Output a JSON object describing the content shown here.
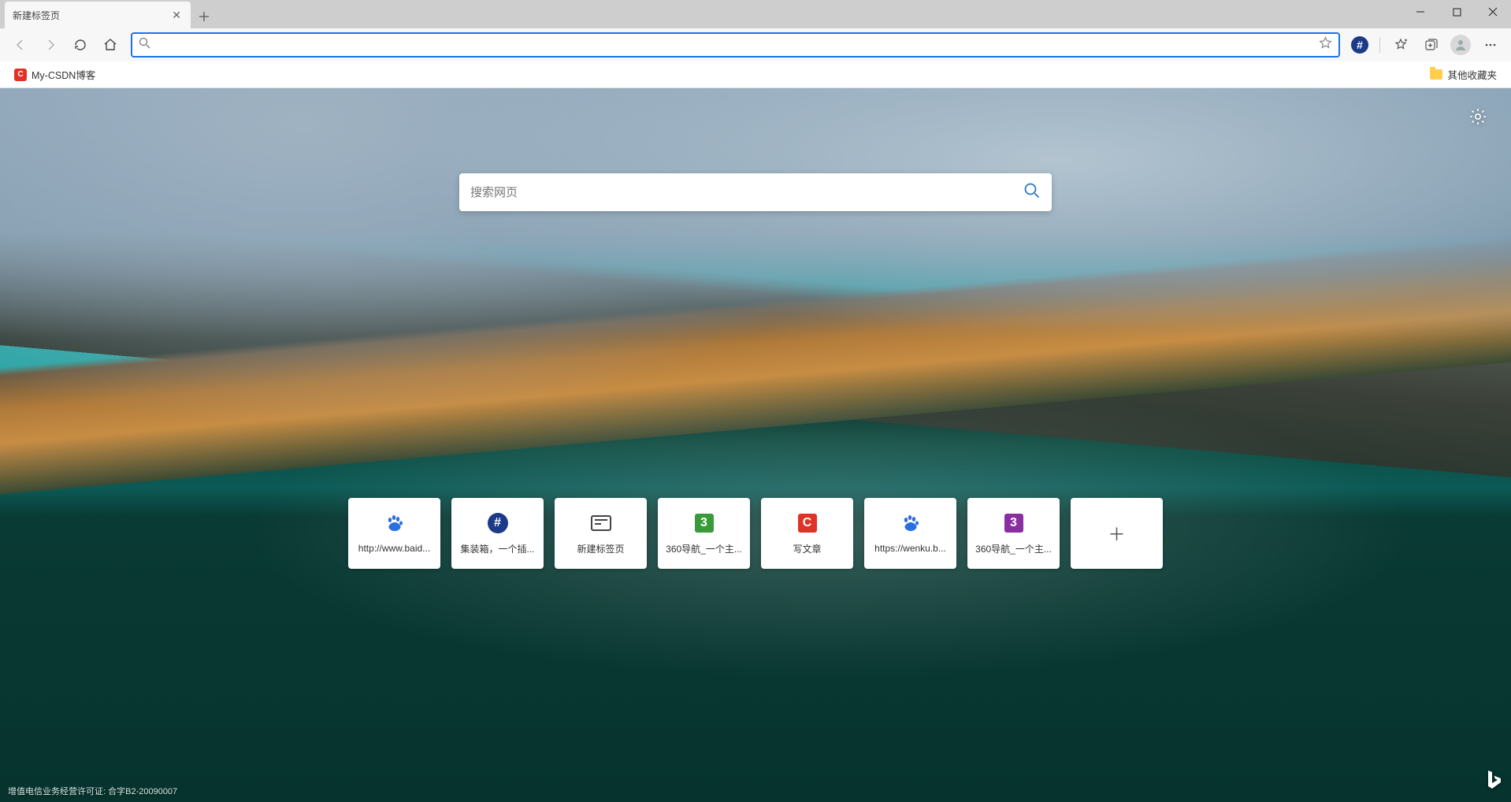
{
  "tab": {
    "title": "新建标签页"
  },
  "bookmarks": {
    "items": [
      {
        "label": "My-CSDN博客"
      }
    ],
    "other_folder": "其他收藏夹"
  },
  "addressbar": {
    "value": "",
    "placeholder": ""
  },
  "ntp": {
    "search_placeholder": "搜索网页",
    "tiles": [
      {
        "label": "http://www.baid...",
        "icon": "baidu"
      },
      {
        "label": "集装箱，一个插...",
        "icon": "hash"
      },
      {
        "label": "新建标签页",
        "icon": "newtab"
      },
      {
        "label": "360导航_一个主...",
        "icon": "green3"
      },
      {
        "label": "写文章",
        "icon": "redC"
      },
      {
        "label": "https://wenku.b...",
        "icon": "baidu"
      },
      {
        "label": "360导航_一个主...",
        "icon": "purple3"
      }
    ],
    "license": "增值电信业务经营许可证: 合字B2-20090007"
  }
}
